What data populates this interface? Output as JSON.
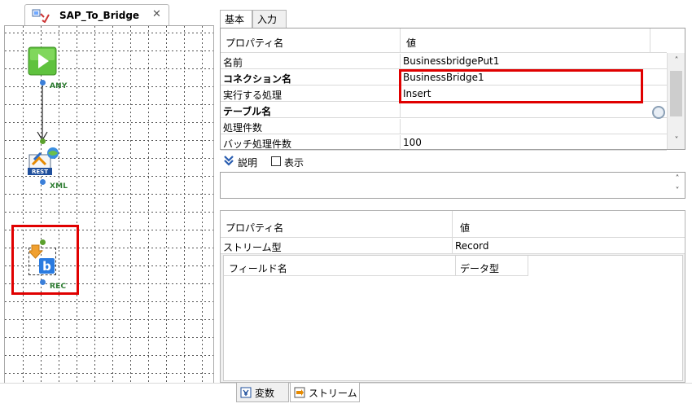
{
  "editor_tab": {
    "title": "SAP_To_Bridge",
    "close": "✕"
  },
  "canvas": {
    "nodes": [
      {
        "name": "start-node",
        "port_label": "ANY"
      },
      {
        "name": "rest-node",
        "icon_text": "REST",
        "port_label": "XML"
      },
      {
        "name": "businessbridge-put-node",
        "port_label": "REC"
      }
    ]
  },
  "property_tabs": [
    "基本",
    "入力"
  ],
  "property_table": {
    "header": {
      "name": "プロパティ名",
      "value": "値"
    },
    "rows": [
      {
        "name": "名前",
        "value": "BusinessbridgePut1",
        "bold": false
      },
      {
        "name": "コネクション名",
        "value": "BusinessBridge1",
        "bold": true
      },
      {
        "name": "実行する処理",
        "value": "Insert",
        "bold": false
      },
      {
        "name": "テーブル名",
        "value": "",
        "bold": true
      },
      {
        "name": "処理件数",
        "value": "",
        "bold": false
      },
      {
        "name": "バッチ処理件数",
        "value": "100",
        "bold": false
      }
    ]
  },
  "description": {
    "label": "説明",
    "show_label": "表示",
    "show_checked": false
  },
  "stream_table": {
    "header": {
      "name": "プロパティ名",
      "value": "値"
    },
    "row": {
      "name": "ストリーム型",
      "value": "Record"
    },
    "field_header": {
      "field": "フィールド名",
      "type": "データ型"
    }
  },
  "bottom_tabs": [
    {
      "label": "変数",
      "active": false,
      "icon": "variable-icon"
    },
    {
      "label": "ストリーム",
      "active": true,
      "icon": "stream-icon"
    }
  ],
  "colors": {
    "highlight": "#e00000",
    "port_label": "#2e7d32",
    "port_blue": "#3b7fd9",
    "port_green": "#5aa02c"
  }
}
